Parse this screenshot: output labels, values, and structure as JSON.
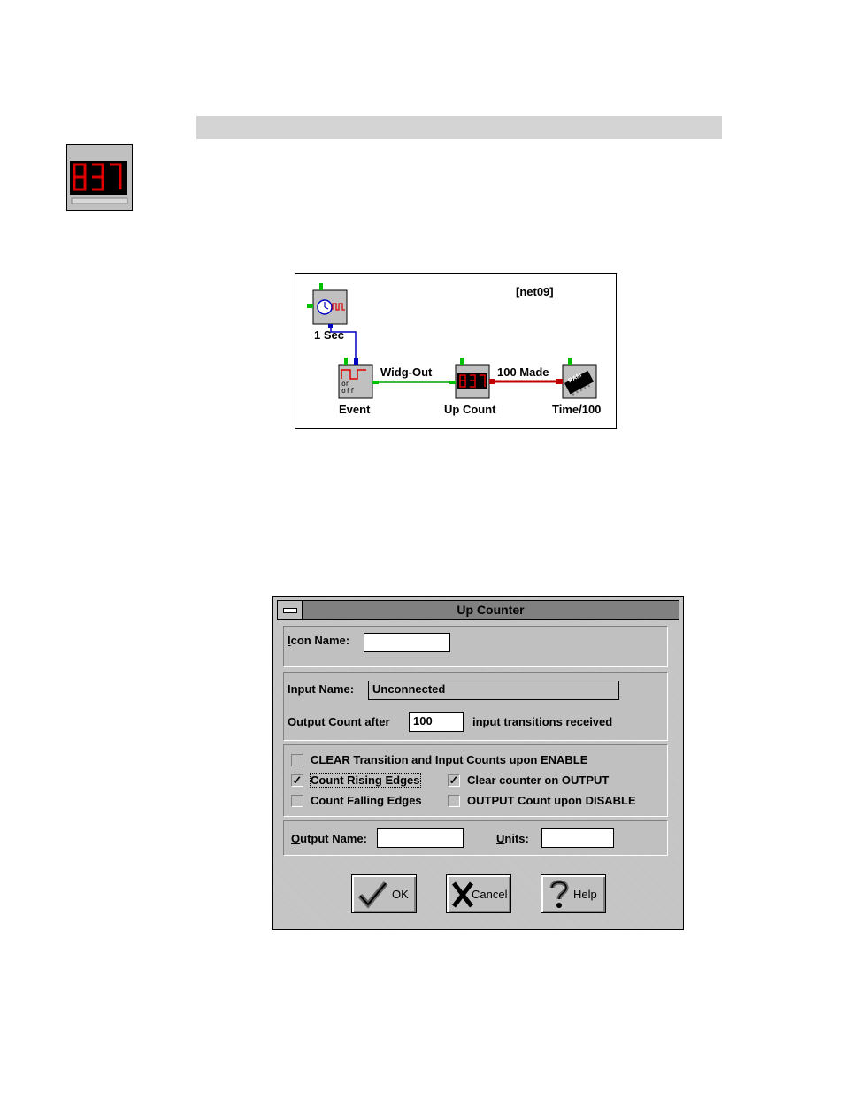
{
  "network": {
    "tag": "[net09]",
    "nodes": {
      "clock": "1 Sec",
      "event": "Event",
      "counter": "Up Count",
      "timer": "Time/100"
    },
    "wires": {
      "event_to_counter": "Widg-Out",
      "counter_to_timer": "100 Made"
    },
    "event_icon_text": "on\noff",
    "ram_icon_text": "RAM"
  },
  "dialog": {
    "title": "Up Counter",
    "icon_name": {
      "label_accel": "I",
      "label_rest": "con Name:",
      "value": ""
    },
    "input_name": {
      "label": "Input Name:",
      "value": "Unconnected"
    },
    "output_count": {
      "label": "Output Count after",
      "value": "100",
      "suffix": "input transitions received"
    },
    "options": {
      "clear_transition": {
        "label": "CLEAR Transition and Input Counts upon ENABLE",
        "checked": false
      },
      "count_rising": {
        "label": "Count Rising Edges",
        "checked": true
      },
      "clear_on_output": {
        "label": "Clear counter on OUTPUT",
        "checked": true
      },
      "count_falling": {
        "label": "Count Falling Edges",
        "checked": false
      },
      "output_on_disable": {
        "label": "OUTPUT Count upon DISABLE",
        "checked": false
      }
    },
    "output_name": {
      "label_accel": "O",
      "label_rest": "utput Name:",
      "value": ""
    },
    "units": {
      "label_accel": "U",
      "label_rest": "nits:",
      "value": ""
    },
    "buttons": {
      "ok": "OK",
      "cancel": "Cancel",
      "help": "Help"
    }
  },
  "colors": {
    "led_red": "#e00000",
    "wire_green": "#00a000",
    "wire_blue": "#0000c0",
    "wire_red": "#c00000"
  }
}
